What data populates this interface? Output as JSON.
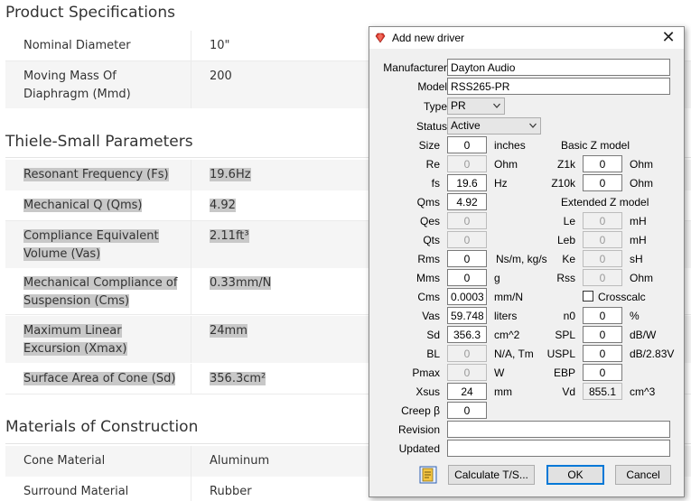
{
  "web": {
    "product_specs": {
      "title": "Product Specifications",
      "rows": [
        {
          "label": "Nominal Diameter",
          "value": "10\""
        },
        {
          "label": "Moving Mass Of Diaphragm (Mmd)",
          "value": "200"
        }
      ]
    },
    "ts_params": {
      "title": "Thiele-Small Parameters",
      "rows": [
        {
          "label": "Resonant Frequency (Fs)",
          "value": "19.6Hz"
        },
        {
          "label": "Mechanical Q (Qms)",
          "value": "4.92"
        },
        {
          "label": "Compliance Equivalent Volume (Vas)",
          "value": "2.11ft³"
        },
        {
          "label": "Mechanical Compliance of Suspension (Cms)",
          "value": "0.33mm/N"
        },
        {
          "label": "Maximum Linear Excursion (Xmax)",
          "value": "24mm"
        },
        {
          "label": "Surface Area of Cone (Sd)",
          "value": "356.3cm²"
        }
      ]
    },
    "materials": {
      "title": "Materials of Construction",
      "rows": [
        {
          "label": "Cone Material",
          "value": "Aluminum"
        },
        {
          "label": "Surround Material",
          "value": "Rubber"
        }
      ]
    }
  },
  "dialog": {
    "title": "Add new driver",
    "icon": "gem-icon",
    "manufacturer": {
      "label": "Manufacturer",
      "value": "Dayton Audio"
    },
    "model": {
      "label": "Model",
      "value": "RSS265-PR"
    },
    "type": {
      "label": "Type",
      "value": "PR"
    },
    "status": {
      "label": "Status",
      "value": "Active"
    },
    "size": {
      "label": "Size",
      "value": "0",
      "unit": "inches"
    },
    "re": {
      "label": "Re",
      "value": "0",
      "unit": "Ohm"
    },
    "fs": {
      "label": "fs",
      "value": "19.6",
      "unit": "Hz"
    },
    "qms": {
      "label": "Qms",
      "value": "4.92"
    },
    "qes": {
      "label": "Qes",
      "value": "0"
    },
    "qts": {
      "label": "Qts",
      "value": "0"
    },
    "rms": {
      "label": "Rms",
      "value": "0",
      "unit": "Ns/m, kg/s"
    },
    "mms": {
      "label": "Mms",
      "value": "0",
      "unit": "g"
    },
    "cms": {
      "label": "Cms",
      "value": "0.0003",
      "unit": "mm/N"
    },
    "vas": {
      "label": "Vas",
      "value": "59.7485",
      "unit": "liters"
    },
    "sd": {
      "label": "Sd",
      "value": "356.3",
      "unit": "cm^2"
    },
    "bl": {
      "label": "BL",
      "value": "0",
      "unit": "N/A, Tm"
    },
    "pmax": {
      "label": "Pmax",
      "value": "0",
      "unit": "W"
    },
    "xsus": {
      "label": "Xsus",
      "value": "24",
      "unit": "mm"
    },
    "creep": {
      "label": "Creep β",
      "value": "0"
    },
    "revision": {
      "label": "Revision",
      "value": ""
    },
    "updated": {
      "label": "Updated",
      "value": ""
    },
    "basic_z": {
      "heading": "Basic Z model",
      "z1k": {
        "label": "Z1k",
        "value": "0",
        "unit": "Ohm"
      },
      "z10k": {
        "label": "Z10k",
        "value": "0",
        "unit": "Ohm"
      }
    },
    "extended_z": {
      "heading": "Extended Z model",
      "le": {
        "label": "Le",
        "value": "0",
        "unit": "mH"
      },
      "leb": {
        "label": "Leb",
        "value": "0",
        "unit": "mH"
      },
      "ke": {
        "label": "Ke",
        "value": "0",
        "unit": "sH"
      },
      "rss": {
        "label": "Rss",
        "value": "0",
        "unit": "Ohm"
      }
    },
    "crosscalc": {
      "label": "Crosscalc",
      "checked": false
    },
    "n0": {
      "label": "n0",
      "value": "0",
      "unit": "%"
    },
    "spl": {
      "label": "SPL",
      "value": "0",
      "unit": "dB/W"
    },
    "uspl": {
      "label": "USPL",
      "value": "0",
      "unit": "dB/2.83V"
    },
    "ebp": {
      "label": "EBP",
      "value": "0"
    },
    "vd": {
      "label": "Vd",
      "value": "855.1",
      "unit": "cm^3"
    },
    "buttons": {
      "notes_icon": "notepad-icon",
      "calculate": "Calculate T/S...",
      "ok": "OK",
      "cancel": "Cancel"
    }
  }
}
